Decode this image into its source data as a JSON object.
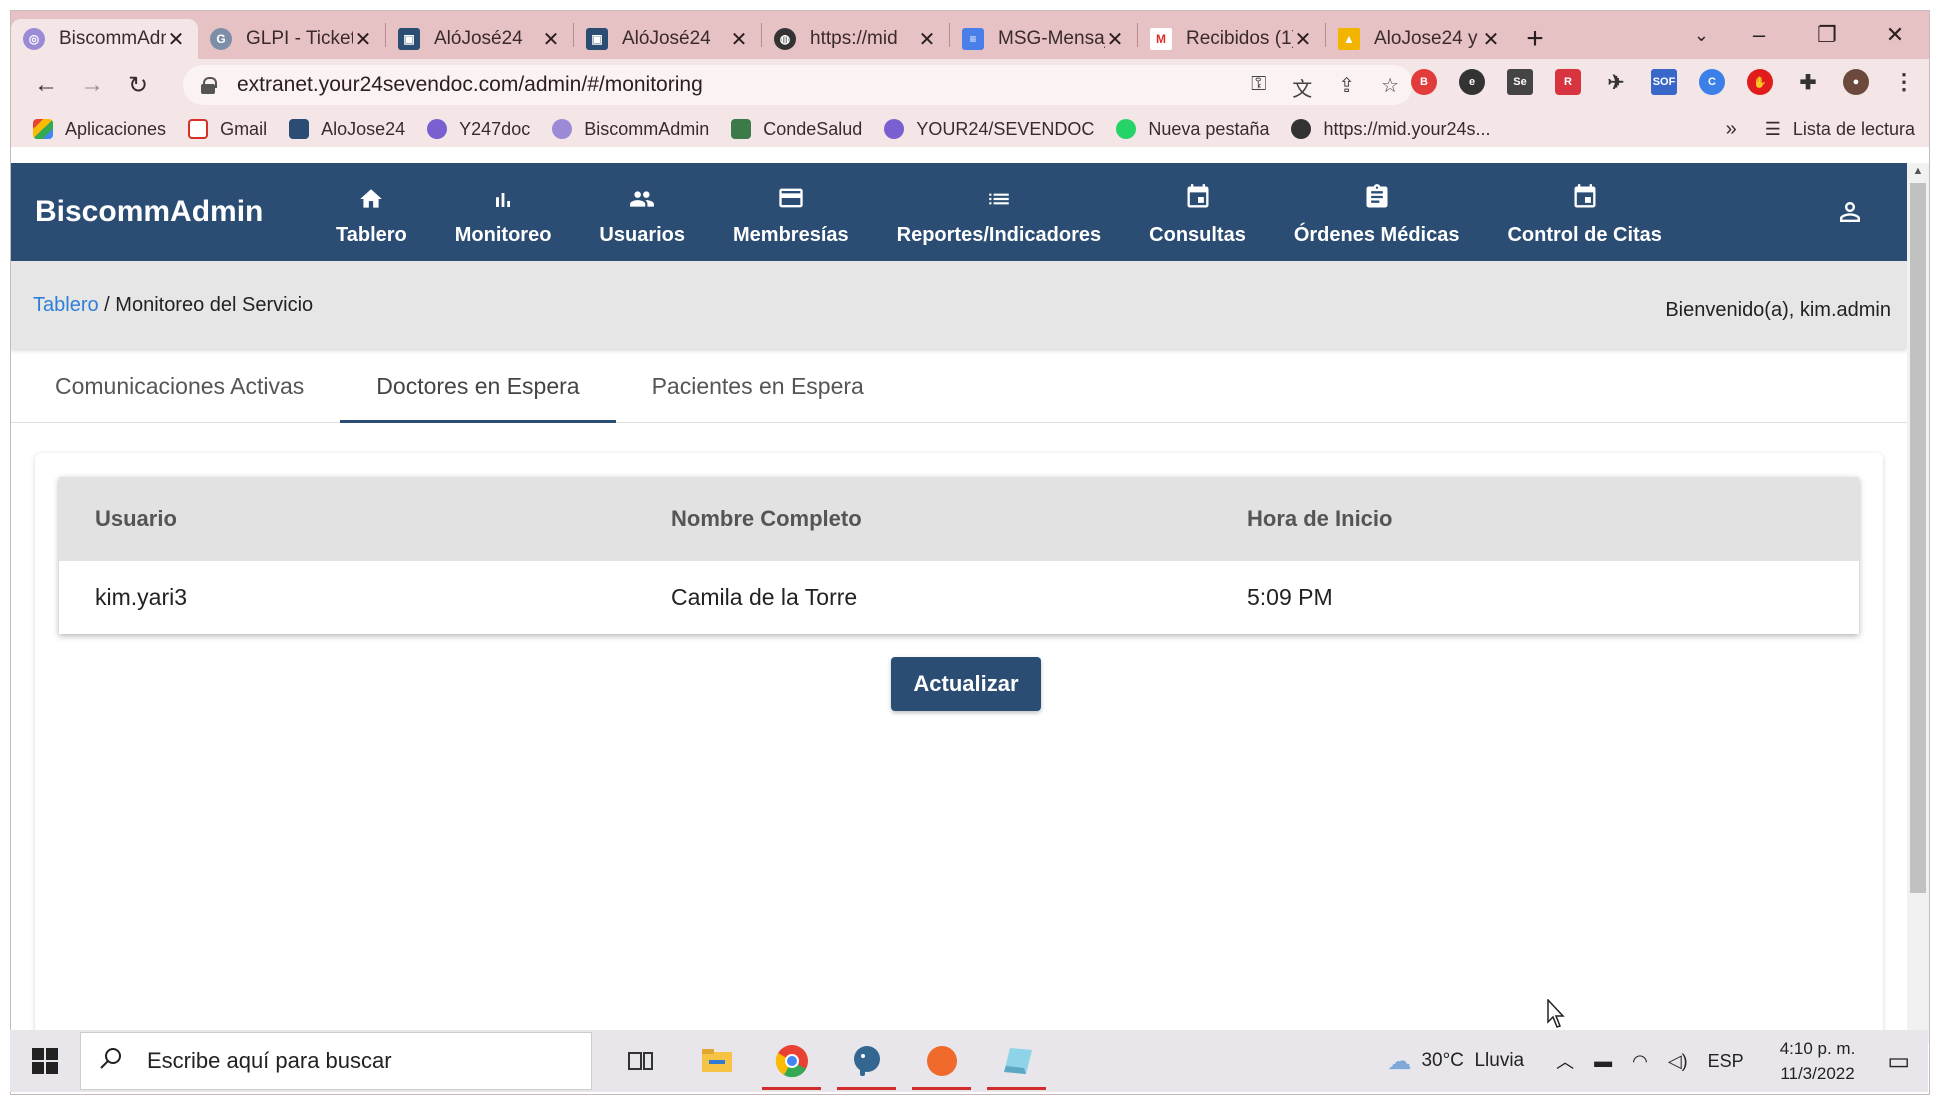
{
  "browser": {
    "tabs": [
      {
        "title": "BiscommAdmin",
        "active": true
      },
      {
        "title": "GLPI - Tickets"
      },
      {
        "title": "AlóJosé24"
      },
      {
        "title": "AlóJosé24"
      },
      {
        "title": "https://mid"
      },
      {
        "title": "MSG-Mensajes"
      },
      {
        "title": "Recibidos (1)"
      },
      {
        "title": "AloJose24 y"
      }
    ],
    "new_tab": "+",
    "address": "extranet.your24sevendoc.com/admin/#/monitoring",
    "bookmarks": [
      {
        "label": "Aplicaciones"
      },
      {
        "label": "Gmail"
      },
      {
        "label": "AloJose24"
      },
      {
        "label": "Y247doc"
      },
      {
        "label": "BiscommAdmin"
      },
      {
        "label": "CondeSalud"
      },
      {
        "label": "YOUR24/SEVENDOC"
      },
      {
        "label": "Nueva pestaña"
      },
      {
        "label": "https://mid.your24s..."
      }
    ],
    "bookmarks_overflow": "»",
    "reading_list": "Lista de lectura"
  },
  "app": {
    "brand": "BiscommAdmin",
    "menu": [
      {
        "label": "Tablero",
        "icon": "home-icon"
      },
      {
        "label": "Monitoreo",
        "icon": "bar-chart-icon"
      },
      {
        "label": "Usuarios",
        "icon": "people-icon"
      },
      {
        "label": "Membresías",
        "icon": "credit-card-icon"
      },
      {
        "label": "Reportes/Indicadores",
        "icon": "list-icon"
      },
      {
        "label": "Consultas",
        "icon": "calendar-icon"
      },
      {
        "label": "Órdenes Médicas",
        "icon": "clipboard-icon"
      },
      {
        "label": "Control de Citas",
        "icon": "calendar-icon"
      }
    ],
    "breadcrumb": {
      "root": "Tablero",
      "separator": " / ",
      "current": "Monitoreo del Servicio"
    },
    "welcome": "Bienvenido(a), kim.admin",
    "tabs": [
      "Comunicaciones Activas",
      "Doctores en Espera",
      "Pacientes en Espera"
    ],
    "active_tab": "Doctores en Espera",
    "table": {
      "headers": [
        "Usuario",
        "Nombre Completo",
        "Hora de Inicio"
      ],
      "rows": [
        [
          "kim.yari3",
          "Camila de la Torre",
          "5:09 PM"
        ]
      ]
    },
    "refresh_button": "Actualizar",
    "colors": {
      "primary": "#2b4d73",
      "link": "#2f7fd8",
      "browser_frame": "#e7c2c4"
    }
  },
  "taskbar": {
    "search_placeholder": "Escribe aquí para buscar",
    "weather": "30°C  Lluvia",
    "language": "ESP",
    "time": "4:10 p. m.",
    "date": "11/3/2022"
  }
}
